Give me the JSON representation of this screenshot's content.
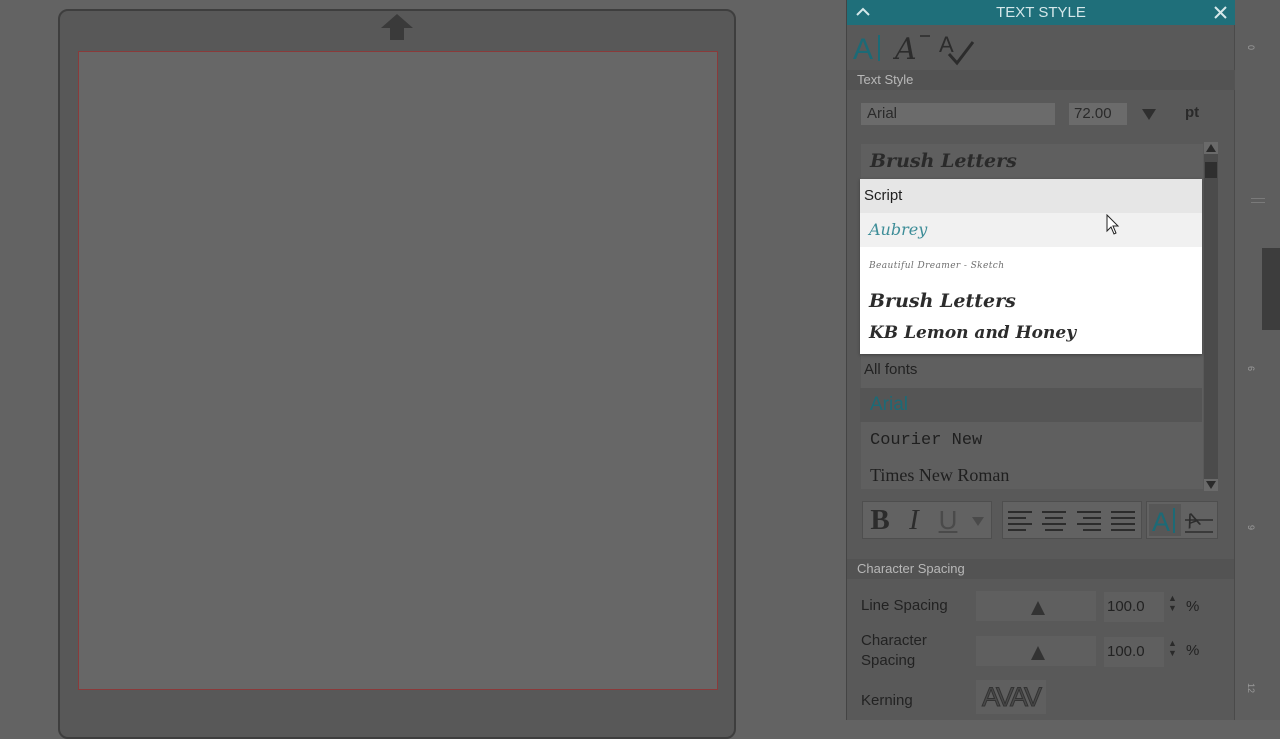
{
  "panel": {
    "title": "TEXT STYLE",
    "collapse_icon": "chevron-up-icon",
    "close_icon": "close-icon",
    "mode_tabs": [
      "text-style-icon",
      "font-style-icon",
      "spell-check-icon"
    ]
  },
  "text_style": {
    "section_label": "Text Style",
    "font_value": "Arial",
    "size_value": "72.00",
    "unit": "pt",
    "list_top_item": "Brush Letters"
  },
  "dropdown": {
    "header": "Script",
    "items": [
      "Aubrey",
      "Beautiful Dreamer - Sketch",
      "Brush Letters",
      "KB Lemon and Honey"
    ],
    "hovered": "Aubrey"
  },
  "all_fonts": {
    "label": "All fonts",
    "items": [
      "Arial",
      "Courier New",
      "Times New Roman"
    ],
    "selected": "Arial"
  },
  "format": {
    "bold": "B",
    "italic": "I",
    "underline": "U"
  },
  "spacing": {
    "section_label": "Character Spacing",
    "line_spacing_label": "Line Spacing",
    "line_spacing_value": "100.0",
    "char_spacing_label": "Character Spacing",
    "char_spacing_value": "100.0",
    "unit": "%",
    "kerning_label": "Kerning",
    "kerning_sample": "AVAV"
  },
  "ruler": {
    "labels": [
      "0",
      "6",
      "9",
      "12"
    ]
  },
  "colors": {
    "header_bg": "#1f6f7a",
    "accent": "#1c6a76",
    "canvas_bg": "#636363",
    "cut_border": "#8a3a3a"
  }
}
